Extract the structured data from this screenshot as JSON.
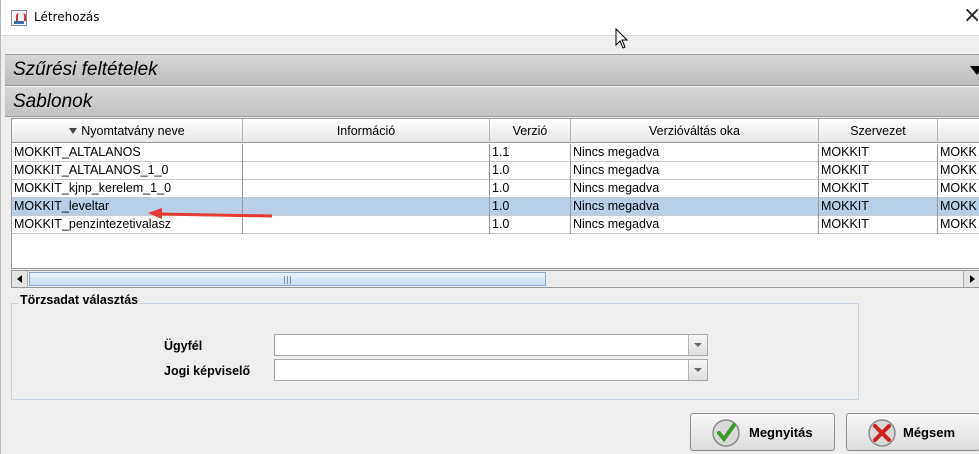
{
  "window": {
    "title": "Létrehozás"
  },
  "filter_section": {
    "title": "Szűrési feltételek"
  },
  "templates_section": {
    "title": "Sablonok"
  },
  "table": {
    "columns": [
      "Nyomtatvány neve",
      "Információ",
      "Verzió",
      "Verzióváltás oka",
      "Szervezet",
      ""
    ],
    "rows": [
      [
        "MOKKIT_ALTALANOS",
        "",
        "1.1",
        "Nincs megadva",
        "MOKKIT",
        "MOKK"
      ],
      [
        "MOKKIT_ALTALANOS_1_0",
        "",
        "1.0",
        "Nincs megadva",
        "MOKKIT",
        "MOKK"
      ],
      [
        "MOKKIT_kjnp_kerelem_1_0",
        "",
        "1.0",
        "Nincs megadva",
        "MOKKIT",
        "MOKK"
      ],
      [
        "MOKKIT_leveltar",
        "",
        "1.0",
        "Nincs megadva",
        "MOKKIT",
        "MOKK"
      ],
      [
        "MOKKIT_penzintezetivalasz",
        "",
        "1.0",
        "Nincs megadva",
        "MOKKIT",
        "MOKK"
      ]
    ],
    "selected_row": 3
  },
  "master_data": {
    "title": "Törzsadat választás",
    "client_label": "Ügyfél",
    "client_value": "",
    "legal_rep_label": "Jogi képviselő",
    "legal_rep_value": ""
  },
  "buttons": {
    "open": "Megnyitás",
    "cancel": "Mégsem"
  },
  "colors": {
    "selected_row": "#b8cfe5",
    "arrow": "#e53935"
  }
}
